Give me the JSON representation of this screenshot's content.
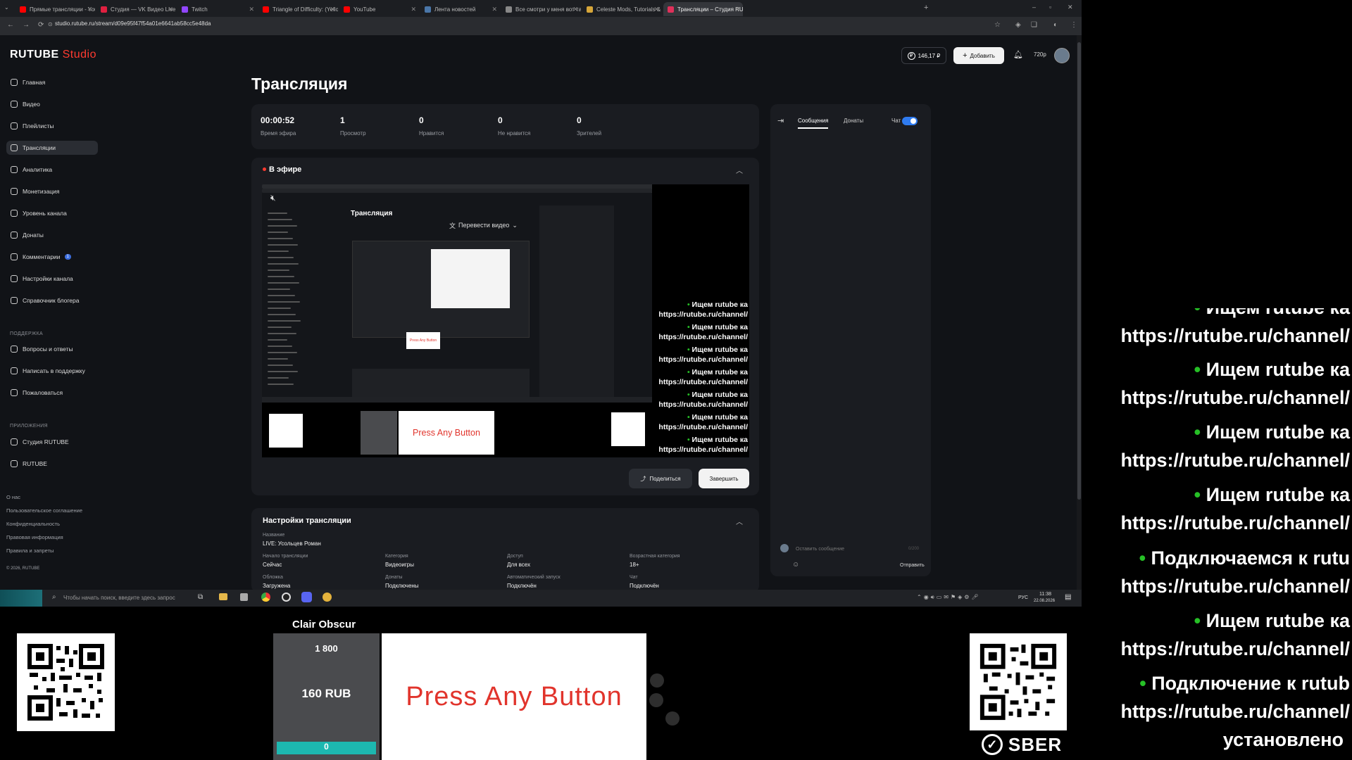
{
  "browser": {
    "tabs": [
      {
        "title": "Прямые трансляции - YouTube",
        "color": "#ff0000"
      },
      {
        "title": "Студия — VK Видео Live",
        "color": "#e02040"
      },
      {
        "title": "Twitch",
        "color": "#9146ff"
      },
      {
        "title": "Triangle of Difficulty: (Yellow, S",
        "color": "#ff0000"
      },
      {
        "title": "YouTube",
        "color": "#ff0000"
      },
      {
        "title": "Лента новостей",
        "color": "#4a76a8"
      },
      {
        "title": "Все смотри у меня вот такой",
        "color": "#888888"
      },
      {
        "title": "Celeste Mods, Tutorials & Com",
        "color": "#d6a63a"
      },
      {
        "title": "Трансляции – Студия RUTUBE",
        "color": "#e0305a"
      }
    ],
    "url": "studio.rutube.ru/stream/d09e95f47f54a01e6641ab58cc5e48da"
  },
  "header": {
    "logo": "RUTUBE",
    "logo_studio": "Studio",
    "balance": "146,17 ₽",
    "add_button": "Добавить",
    "quality": "720p"
  },
  "sidebar": {
    "items": [
      {
        "label": "Главная",
        "active": false
      },
      {
        "label": "Видео",
        "active": false
      },
      {
        "label": "Плейлисты",
        "active": false
      },
      {
        "label": "Трансляции",
        "active": true
      },
      {
        "label": "Аналитика",
        "active": false
      },
      {
        "label": "Монетизация",
        "active": false
      },
      {
        "label": "Уровень канала",
        "active": false
      },
      {
        "label": "Донаты",
        "active": false
      },
      {
        "label": "Комментарии",
        "active": false,
        "badge": "1"
      },
      {
        "label": "Настройки канала",
        "active": false
      },
      {
        "label": "Справочник блогера",
        "active": false
      }
    ],
    "support_title": "ПОДДЕРЖКА",
    "support_items": [
      "Вопросы и ответы",
      "Написать в поддержку",
      "Пожаловаться"
    ],
    "apps_title": "ПРИЛОЖЕНИЯ",
    "apps_items": [
      "Студия RUTUBE",
      "RUTUBE"
    ],
    "footer_links": [
      "О нас",
      "Пользовательское соглашение",
      "Конфиденциальность",
      "Правовая информация",
      "Правила и запреты"
    ],
    "copyright": "© 2026, RUTUBE"
  },
  "main": {
    "title": "Трансляция",
    "stats": [
      {
        "value": "00:00:52",
        "label": "Время эфира"
      },
      {
        "value": "1",
        "label": "Просмотр"
      },
      {
        "value": "0",
        "label": "Нравится"
      },
      {
        "value": "0",
        "label": "Не нравится"
      },
      {
        "value": "0",
        "label": "Зрителей"
      }
    ],
    "live_title": "В эфире",
    "share_button": "Поделиться",
    "end_button": "Завершить",
    "settings_title": "Настройки трансляции",
    "settings": {
      "name_key": "Название",
      "name_value": "LIVE: Усольцев Роман",
      "rows": [
        [
          {
            "key": "Начало трансляции",
            "value": "Сейчас"
          },
          {
            "key": "Категория",
            "value": "Видеоигры"
          },
          {
            "key": "Доступ",
            "value": "Для всех"
          },
          {
            "key": "Возрастная категория",
            "value": "18+"
          }
        ],
        [
          {
            "key": "Обложка",
            "value": "Загружена"
          },
          {
            "key": "Донаты",
            "value": "Подключены"
          },
          {
            "key": "Автоматический запуск",
            "value": "Подключён"
          },
          {
            "key": "Чат",
            "value": "Подключён"
          }
        ]
      ]
    }
  },
  "chat": {
    "tabs": [
      "Сообщения",
      "Донаты"
    ],
    "toggle_label": "Чат",
    "toggle_on": true,
    "input_placeholder": "Оставить сообщение",
    "counter": "0/200",
    "send_button": "Отправить"
  },
  "preview": {
    "inner_title": "Трансляция",
    "translate_label": "Перевести видео",
    "chat_lines": [
      {
        "line1": "Ищем rutube ка",
        "line2": "https://rutube.ru/channel/"
      },
      {
        "line1": "Ищем rutube ка",
        "line2": "https://rutube.ru/channel/"
      },
      {
        "line1": "Ищем rutube ка",
        "line2": "https://rutube.ru/channel/"
      },
      {
        "line1": "Ищем rutube ка",
        "line2": "https://rutube.ru/channel/"
      },
      {
        "line1": "Ищем rutube ка",
        "line2": "https://rutube.ru/channel/"
      },
      {
        "line1": "Ищем rutube ка",
        "line2": "https://rutube.ru/channel/"
      },
      {
        "line1": "Ищем rutube ка",
        "line2": "https://rutube.ru/channel/"
      }
    ]
  },
  "taskbar": {
    "search_placeholder": "Чтобы начать поиск, введите здесь запрос",
    "lang": "РУС",
    "time": "11:38",
    "date": "22.08.2026"
  },
  "overlay": {
    "game_title": "Clair Obscur",
    "goal_amount": "1 800",
    "goal_current": "160 RUB",
    "goal_progress_label": "0",
    "goal_progress": 0.0,
    "press_text": "Press Any Button",
    "sber_label": "SBER",
    "chat_lines": [
      {
        "line1": "Ищем rutube ка",
        "line2": "https://rutube.ru/channel/"
      },
      {
        "line1": "Ищем rutube ка",
        "line2": "https://rutube.ru/channel/"
      },
      {
        "line1": "Ищем rutube ка",
        "line2": "https://rutube.ru/channel/"
      },
      {
        "line1": "Ищем rutube ка",
        "line2": "https://rutube.ru/channel/"
      },
      {
        "line1": "Подключаемся к rutu",
        "line2": "https://rutube.ru/channel/"
      },
      {
        "line1": "Ищем rutube ка",
        "line2": "https://rutube.ru/channel/"
      },
      {
        "line1": "Подключение к rutub",
        "line2": "https://rutube.ru/channel/",
        "line3": "установлено"
      }
    ]
  }
}
